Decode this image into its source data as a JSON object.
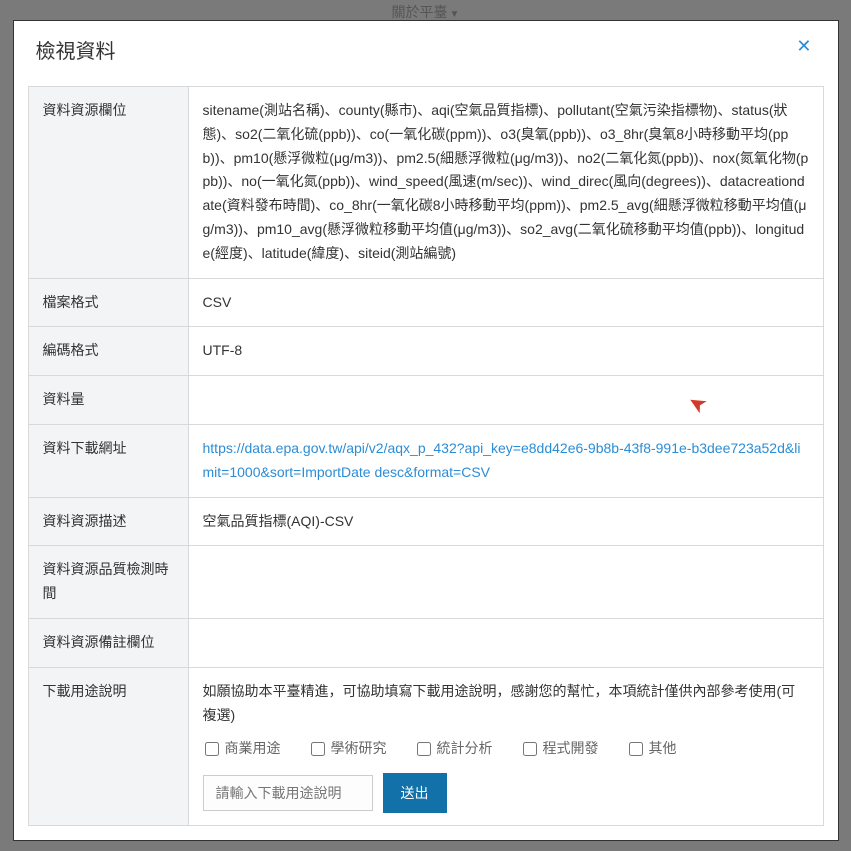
{
  "backdrop": {
    "nav_label": "關於平臺"
  },
  "modal": {
    "title": "檢視資料",
    "close": "✕"
  },
  "rows": {
    "fields_label": "資料資源欄位",
    "fields_value": "sitename(測站名稱)、county(縣市)、aqi(空氣品質指標)、pollutant(空氣污染指標物)、status(狀態)、so2(二氧化硫(ppb))、co(一氧化碳(ppm))、o3(臭氧(ppb))、o3_8hr(臭氧8小時移動平均(ppb))、pm10(懸浮微粒(μg/m3))、pm2.5(細懸浮微粒(μg/m3))、no2(二氧化氮(ppb))、nox(氮氧化物(ppb))、no(一氧化氮(ppb))、wind_speed(風速(m/sec))、wind_direc(風向(degrees))、datacreationdate(資料發布時間)、co_8hr(一氧化碳8小時移動平均(ppm))、pm2.5_avg(細懸浮微粒移動平均值(μg/m3))、pm10_avg(懸浮微粒移動平均值(μg/m3))、so2_avg(二氧化硫移動平均值(ppb))、longitude(經度)、latitude(緯度)、siteid(測站編號)",
    "format_label": "檔案格式",
    "format_value": "CSV",
    "encoding_label": "編碼格式",
    "encoding_value": "UTF-8",
    "size_label": "資料量",
    "size_value": "",
    "url_label": "資料下載網址",
    "url_value": "https://data.epa.gov.tw/api/v2/aqx_p_432?api_key=e8dd42e6-9b8b-43f8-991e-b3dee723a52d&limit=1000&sort=ImportDate desc&format=CSV",
    "desc_label": "資料資源描述",
    "desc_value": "空氣品質指標(AQI)-CSV",
    "qc_label": "資料資源品質檢測時間",
    "qc_value": "",
    "remark_label": "資料資源備註欄位",
    "remark_value": "",
    "usage_label": "下載用途說明",
    "usage_desc": "如願協助本平臺精進，可協助填寫下載用途說明，感謝您的幫忙，本項統計僅供內部參考使用(可複選)"
  },
  "checkboxes": {
    "c1": "商業用途",
    "c2": "學術研究",
    "c3": "統計分析",
    "c4": "程式開發",
    "c5": "其他"
  },
  "input": {
    "placeholder": "請輸入下載用途說明",
    "submit": "送出"
  }
}
